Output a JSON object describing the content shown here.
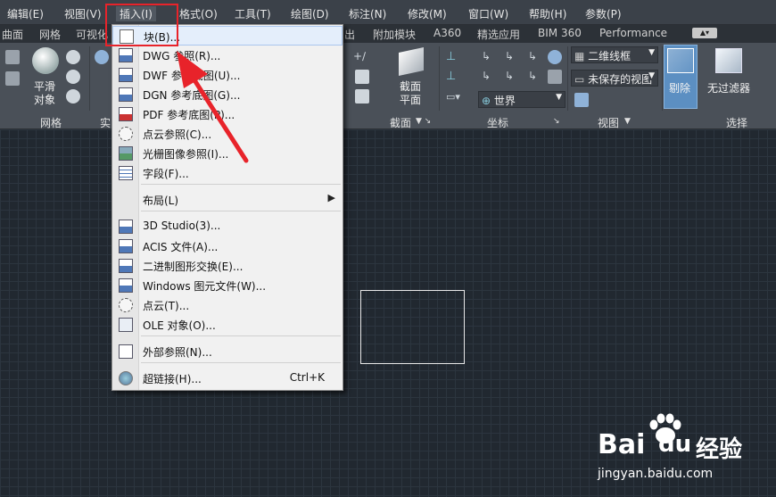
{
  "menubar": {
    "items": [
      "编辑(E)",
      "视图(V)",
      "插入(I)",
      "格式(O)",
      "工具(T)",
      "绘图(D)",
      "标注(N)",
      "修改(M)",
      "窗口(W)",
      "帮助(H)",
      "参数(P)"
    ]
  },
  "ribbon_tabs": [
    "曲面",
    "网格",
    "可视化",
    "出",
    "附加模块",
    "A360",
    "精选应用",
    "BIM 360",
    "Performance"
  ],
  "ribbon": {
    "mesh_smooth": "平滑\n对象",
    "panel_mesh": "网格",
    "panel_solid_partial": "实",
    "section_plane": "截面\n平面",
    "panel_section": "截面",
    "panel_coords": "坐标",
    "panel_view": "视图",
    "panel_select": "选择",
    "cull_label": "剔除",
    "no_filter_label": "无过滤器",
    "visual_style": "二维线框",
    "saved_view": "未保存的视图",
    "ucs_world": "世界"
  },
  "insert_menu": {
    "items": [
      {
        "label": "块(B)...",
        "icon": "block-icon"
      },
      {
        "label": "DWG 参照(R)...",
        "icon": "dwg-reference-icon"
      },
      {
        "label": "DWF 参考底图(U)...",
        "icon": "dwf-underlay-icon"
      },
      {
        "label": "DGN 参考底图(G)...",
        "icon": "dgn-underlay-icon"
      },
      {
        "label": "PDF 参考底图(P)...",
        "icon": "pdf-underlay-icon"
      },
      {
        "label": "点云参照(C)...",
        "icon": "point-cloud-reference-icon"
      },
      {
        "label": "光栅图像参照(I)...",
        "icon": "raster-image-icon"
      },
      {
        "label": "字段(F)...",
        "icon": "field-icon"
      },
      {
        "label": "布局(L)",
        "icon": "",
        "submenu": true
      },
      {
        "label": "3D Studio(3)...",
        "icon": "3ds-icon"
      },
      {
        "label": "ACIS 文件(A)...",
        "icon": "acis-icon"
      },
      {
        "label": "二进制图形交换(E)...",
        "icon": "dxb-icon"
      },
      {
        "label": "Windows 图元文件(W)...",
        "icon": "wmf-icon"
      },
      {
        "label": "点云(T)...",
        "icon": "point-cloud-icon"
      },
      {
        "label": "OLE 对象(O)...",
        "icon": "ole-object-icon"
      },
      {
        "label": "外部参照(N)...",
        "icon": "xref-icon"
      },
      {
        "label": "超链接(H)...",
        "icon": "hyperlink-icon",
        "shortcut": "Ctrl+K"
      }
    ]
  },
  "watermark": {
    "brand": "Bai",
    "brand2": "经验",
    "site": "jingyan.baidu.com"
  },
  "colors": {
    "highlight_box": "#e8232a",
    "arrow": "#e8232a",
    "menu_hover": "#e4eefb"
  }
}
